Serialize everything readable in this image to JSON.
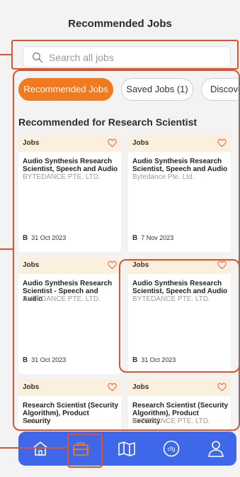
{
  "header": {
    "title": "Recommended Jobs"
  },
  "search": {
    "placeholder": "Search all jobs"
  },
  "tabs": [
    {
      "label": "Recommended Jobs",
      "active": true
    },
    {
      "label": "Saved Jobs (1)",
      "active": false
    },
    {
      "label": "Discover",
      "active": false
    }
  ],
  "section": {
    "title": "Recommended for Research Scientist"
  },
  "cards": [
    {
      "tag": "Jobs",
      "title": "Audio Synthesis Research Scientist, Speech and Audio",
      "company": "BYTEDANCE PTE. LTD.",
      "initial": "B",
      "date": "31 Oct 2023"
    },
    {
      "tag": "Jobs",
      "title": "Audio Synthesis Research Scientist, Speech and Audio",
      "company": "Bytedance Pte. Ltd.",
      "initial": "B",
      "date": "7 Nov 2023"
    },
    {
      "tag": "Jobs",
      "title": "Audio Synthesis Research Scientist - Speech and Audio",
      "company": "BYTEDANCE PTE. LTD.",
      "initial": "B",
      "date": "31 Oct 2023"
    },
    {
      "tag": "Jobs",
      "title": "Audio Synthesis Research Scientist, Speech and Audio",
      "company": "BYTEDANCE PTE. LTD.",
      "initial": "B",
      "date": "31 Oct 2023"
    },
    {
      "tag": "Jobs",
      "title": "Research Scientist (Security Algorithm), Product Security",
      "company": "Lark",
      "initial": "",
      "date": ""
    },
    {
      "tag": "Jobs",
      "title": "Research Scientist (Security Algorithm), Product Security",
      "company": "BYTEDANCE PTE. LTD.",
      "initial": "",
      "date": ""
    }
  ],
  "nav": [
    {
      "icon": "home-icon"
    },
    {
      "icon": "briefcase-icon",
      "active": true
    },
    {
      "icon": "book-map-icon"
    },
    {
      "icon": "cfg-icon",
      "label": "cfg"
    },
    {
      "icon": "profile-icon"
    }
  ],
  "colors": {
    "accent": "#f07a1f",
    "nav": "#3f67ea",
    "annotation": "#dd5230",
    "card_header": "#fbf0dd"
  }
}
